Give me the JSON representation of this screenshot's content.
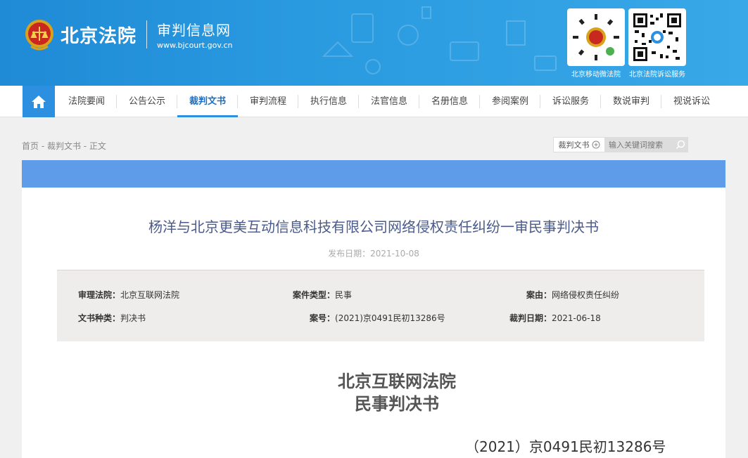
{
  "header": {
    "site_name": "北京法院",
    "sub_title": "审判信息网",
    "url": "www.bjcourt.gov.cn",
    "qr_codes": [
      {
        "caption": "北京移动微法院"
      },
      {
        "caption": "北京法院诉讼服务"
      }
    ]
  },
  "nav": {
    "home_icon": "home-icon",
    "items": [
      "法院要闻",
      "公告公示",
      "裁判文书",
      "审判流程",
      "执行信息",
      "法官信息",
      "名册信息",
      "参阅案例",
      "诉讼服务",
      "数说审判",
      "视说诉讼"
    ],
    "active": "裁判文书"
  },
  "breadcrumb": "首页 - 裁判文书 - 正文",
  "search": {
    "category": "裁判文书",
    "placeholder": "输入关键词搜索"
  },
  "document": {
    "title": "杨洋与北京更美互动信息科技有限公司网络侵权责任纠纷一审民事判决书",
    "publish_date": "发布日期：2021-10-08",
    "info": {
      "court_label": "审理法院：",
      "court": "北京互联网法院",
      "case_type_label": "案件类型：",
      "case_type": "民事",
      "cause_label": "案由：",
      "cause": "网络侵权责任纠纷",
      "doc_type_label": "文书种类：",
      "doc_type": "判决书",
      "case_no_label": "案号：",
      "case_no": "(2021)京0491民初13286号",
      "judgment_date_label": "裁判日期：",
      "judgment_date": "2021-06-18"
    },
    "heading_line1": "北京互联网法院",
    "heading_line2": "民事判决书",
    "case_number": "（2021）京0491民初13286号"
  },
  "colors": {
    "banner": "#2a9ae0",
    "nav_active": "#2d8fe0",
    "strip": "#5e9be8",
    "title": "#4a5a8a"
  }
}
